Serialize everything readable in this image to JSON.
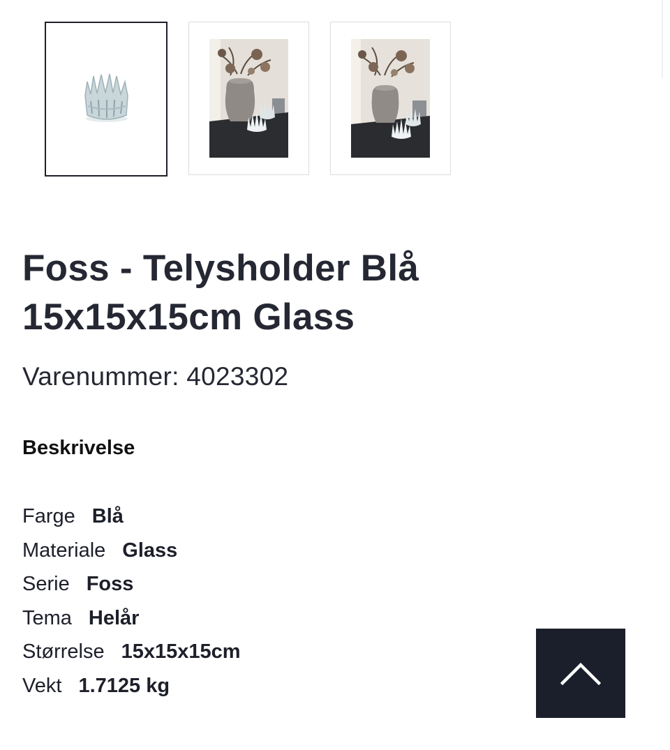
{
  "gallery": {
    "thumbnails": [
      {
        "subject": "candle holder product photo",
        "selected": true
      },
      {
        "subject": "lifestyle photo with vase and candle holders",
        "selected": false
      },
      {
        "subject": "lifestyle photo with vase and candle holders",
        "selected": false
      }
    ]
  },
  "product": {
    "title": "Foss - Telysholder Blå 15x15x15cm Glass",
    "sku_text": "Varenummer: 4023302"
  },
  "description": {
    "heading": "Beskrivelse",
    "attributes": [
      {
        "key": "Farge",
        "value": "Blå"
      },
      {
        "key": "Materiale",
        "value": "Glass"
      },
      {
        "key": "Serie",
        "value": "Foss"
      },
      {
        "key": "Tema",
        "value": "Helår"
      },
      {
        "key": "Størrelse",
        "value": "15x15x15cm"
      },
      {
        "key": "Vekt",
        "value": "1.7125 kg"
      }
    ]
  },
  "back_to_top": {
    "icon": "chevron-up-icon"
  },
  "colors": {
    "text": "#252833",
    "button_bg": "#1b1e2b",
    "thumb_selected_border": "#1d1f2a",
    "thumb_border": "#dcdcdc"
  }
}
